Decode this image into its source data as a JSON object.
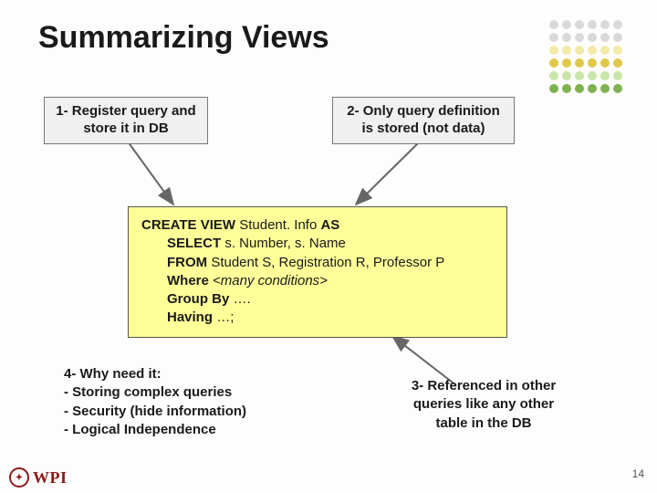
{
  "title": "Summarizing Views",
  "box1": {
    "line1": "1- Register query and",
    "line2": "store it in DB"
  },
  "box2": {
    "line1": "2- Only query definition",
    "line2": "is stored (not data)"
  },
  "box3": {
    "line1": "3- Referenced in other",
    "line2": "queries like any other",
    "line3": "table in the DB"
  },
  "box4": {
    "line1": "4- Why need it:",
    "line2": "- Storing complex queries",
    "line3": "- Security (hide information)",
    "line4": "- Logical Independence"
  },
  "sql": {
    "l1_kw": "CREATE VIEW ",
    "l1_name": "Student. Info ",
    "l1_as": "AS",
    "l2_kw": "SELECT ",
    "l2_rest": "s. Number, s. Name",
    "l3_kw": "FROM ",
    "l3_rest": "Student S, Registration R, Professor P",
    "l4_kw": "Where ",
    "l4_rest": "<many conditions>",
    "l5_kw": "Group By ",
    "l5_rest": "….",
    "l6_kw": "Having ",
    "l6_rest": "…;"
  },
  "page_number": "14",
  "logo_text": "WPI"
}
